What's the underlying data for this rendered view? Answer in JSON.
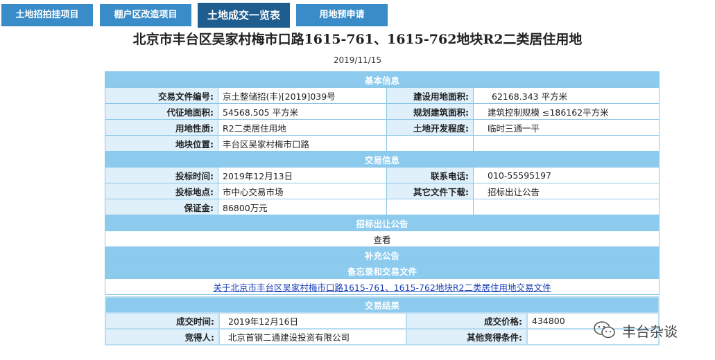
{
  "tabs": [
    {
      "label": "土地招拍挂项目"
    },
    {
      "label": "棚户区改造项目"
    },
    {
      "label": "土地成交一览表"
    },
    {
      "label": "用地预申请"
    }
  ],
  "title": "北京市丰台区吴家村梅市口路1615-761、1615-762地块R2二类居住用地",
  "date": "2019/11/15",
  "basic": {
    "header": "基本信息",
    "doc_no_label": "交易文件编号:",
    "doc_no": "京土整储招(丰)[2019]039号",
    "build_area_label": "建设用地面积:",
    "build_area": "62168.343 平方米",
    "requisition_label": "代征地面积:",
    "requisition": "54568.505 平方米",
    "plan_area_label": "规划建筑面积:",
    "plan_area": "建筑控制规模 ≤186162平方米",
    "nature_label": "用地性质:",
    "nature": "R2二类居住用地",
    "dev_label": "土地开发程度:",
    "dev": "临时三通一平",
    "location_label": "地块位置:",
    "location": "丰台区吴家村梅市口路"
  },
  "trade": {
    "header": "交易信息",
    "bid_time_label": "投标时间:",
    "bid_time": "2019年12月13日",
    "phone_label": "联系电话:",
    "phone": "010-55595197",
    "bid_place_label": "投标地点:",
    "bid_place": "市中心交易市场",
    "download_label": "其它文件下载:",
    "download": "招标出让公告",
    "deposit_label": "保证金:",
    "deposit": "86800万元"
  },
  "notice": {
    "header": "招标出让公告",
    "view": "查看"
  },
  "supplement": {
    "header": "补充公告"
  },
  "memo": {
    "header": "备忘录和交易文件",
    "link": "关于北京市丰台区吴家村梅市口路1615-761、1615-762地块R2二类居住用地交易文件"
  },
  "result": {
    "header": "交易结果",
    "deal_time_label": "成交时间:",
    "deal_time": "2019年12月16日",
    "price_label": "成交价格:",
    "price": "434800",
    "winner_label": "竞得人:",
    "winner": "北京首钢二通建设投资有限公司",
    "other_label": "其他竞得条件:",
    "other": ""
  },
  "watermark": {
    "icon": "wechat-icon",
    "text": "丰台杂谈"
  }
}
